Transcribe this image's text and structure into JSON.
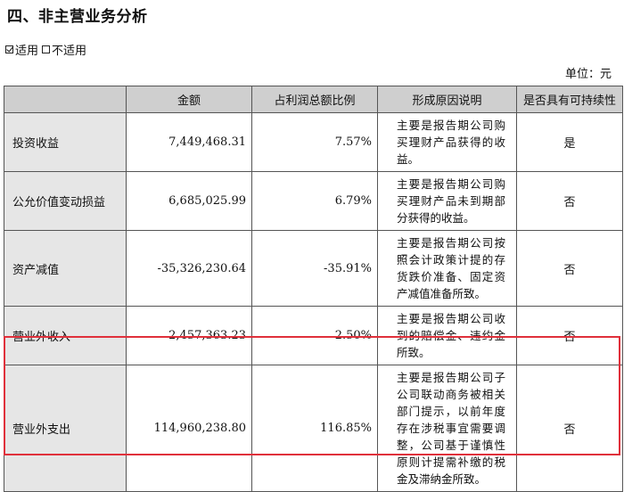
{
  "section_title": "四、非主营业务分析",
  "options": {
    "applicable": "适用",
    "not_applicable": "不适用",
    "applicable_checked": true
  },
  "unit_label": "单位：元",
  "table": {
    "headers": [
      "",
      "金额",
      "占利润总额比例",
      "形成原因说明",
      "是否具有可持续性"
    ],
    "rows": [
      {
        "item": "投资收益",
        "amount": "7,449,468.31",
        "ratio": "7.57%",
        "reason": "主要是报告期公司购买理财产品获得的收益。",
        "sustainable": "是"
      },
      {
        "item": "公允价值变动损益",
        "amount": "6,685,025.99",
        "ratio": "6.79%",
        "reason": "主要是报告期公司购买理财产品未到期部分获得的收益。",
        "sustainable": "否"
      },
      {
        "item": "资产减值",
        "amount": "-35,326,230.64",
        "ratio": "-35.91%",
        "reason": "主要是报告期公司按照会计政策计提的存货跌价准备、固定资产减值准备所致。",
        "sustainable": "否"
      },
      {
        "item": "营业外收入",
        "amount": "2,457,363.23",
        "ratio": "2.50%",
        "reason": "主要是报告期公司收到的赔偿金、违约金所致。",
        "sustainable": "否"
      },
      {
        "item": "营业外支出",
        "amount": "114,960,238.80",
        "ratio": "116.85%",
        "reason": "主要是报告期公司子公司联动商务被相关部门提示，以前年度存在涉税事宜需要调整，公司基于谨慎性原则计提需补缴的税金及滞纳金所致。",
        "sustainable": "否"
      }
    ]
  },
  "highlight_color": "#e0303b"
}
